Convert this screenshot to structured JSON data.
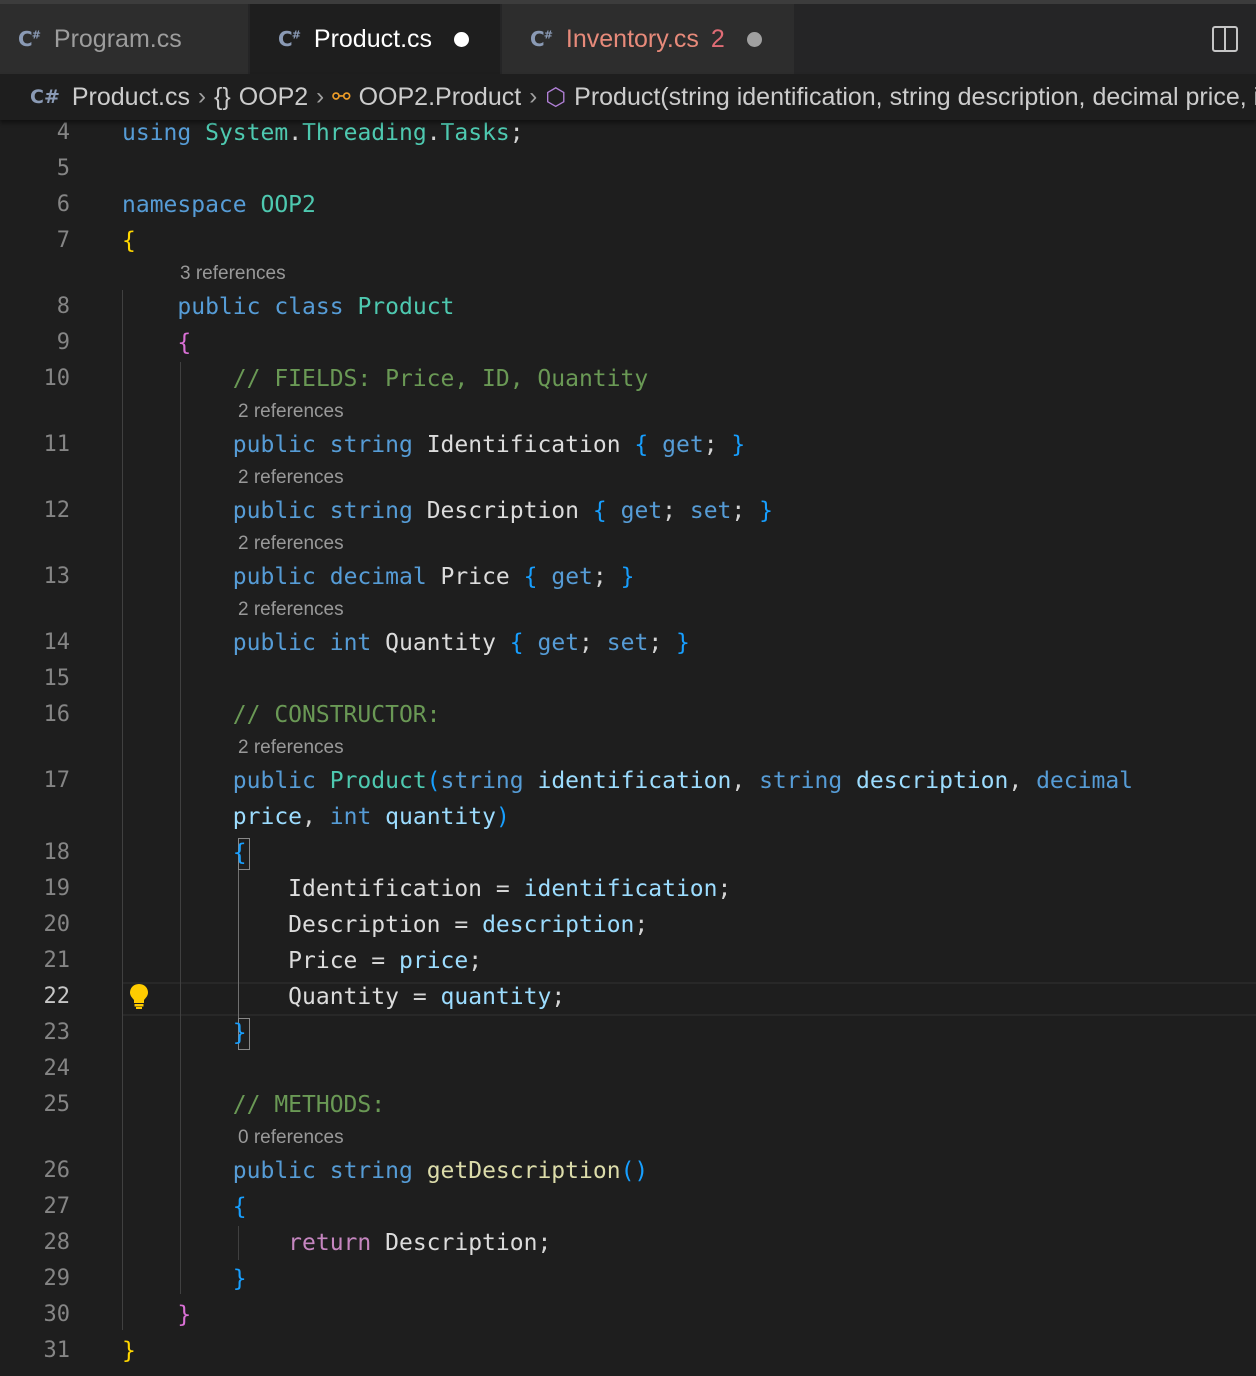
{
  "tabs": [
    {
      "name": "Program.cs",
      "state": "inactive",
      "modified": false,
      "errors": ""
    },
    {
      "name": "Product.cs",
      "state": "active",
      "modified": true,
      "errors": ""
    },
    {
      "name": "Inventory.cs",
      "state": "inactive",
      "modified": true,
      "errors": "2"
    }
  ],
  "breadcrumb": {
    "file": "Product.cs",
    "namespace": "OOP2",
    "class": "OOP2.Product",
    "method": "Product(string identification, string description, decimal price, int quantity)"
  },
  "editor": {
    "current_line": 22,
    "line_numbers": [
      "4",
      "5",
      "6",
      "7",
      "8",
      "9",
      "10",
      "11",
      "12",
      "13",
      "14",
      "15",
      "16",
      "17",
      "18",
      "19",
      "20",
      "21",
      "22",
      "23",
      "24",
      "25",
      "26",
      "27",
      "28",
      "29",
      "30",
      "31"
    ],
    "codelens": {
      "class_product": "3 references",
      "identification": "2 references",
      "description": "2 references",
      "price": "2 references",
      "quantity": "2 references",
      "constructor": "2 references",
      "get_description": "0 references"
    },
    "code": {
      "l4": [
        "using",
        "System",
        ".",
        "Threading",
        ".",
        "Tasks",
        ";"
      ],
      "l6": [
        "namespace",
        "OOP2"
      ],
      "l7": "{",
      "l8": [
        "public",
        "class",
        "Product"
      ],
      "l9": "{",
      "l10": "// FIELDS: Price, ID, Quantity",
      "l11": [
        "public",
        "string",
        "Identification",
        "{",
        "get",
        ";",
        "}"
      ],
      "l12": [
        "public",
        "string",
        "Description",
        "{",
        "get",
        ";",
        "set",
        ";",
        "}"
      ],
      "l13": [
        "public",
        "decimal",
        "Price",
        "{",
        "get",
        ";",
        "}"
      ],
      "l14": [
        "public",
        "int",
        "Quantity",
        "{",
        "get",
        ";",
        "set",
        ";",
        "}"
      ],
      "l16": "// CONSTRUCTOR:",
      "l17a": [
        "public",
        "Product",
        "(",
        "string",
        "identification",
        ",",
        "string",
        "description",
        ",",
        "decimal"
      ],
      "l17b": [
        "price",
        ",",
        "int",
        "quantity",
        ")"
      ],
      "l18": "{",
      "l19": [
        "Identification",
        "=",
        "identification",
        ";"
      ],
      "l20": [
        "Description",
        "=",
        "description",
        ";"
      ],
      "l21": [
        "Price",
        "=",
        "price",
        ";"
      ],
      "l22": [
        "Quantity",
        "=",
        "quantity",
        ";"
      ],
      "l23": "}",
      "l25": "// METHODS:",
      "l26": [
        "public",
        "string",
        "getDescription",
        "()"
      ],
      "l27": "{",
      "l28": [
        "return",
        "Description",
        ";"
      ],
      "l29": "}",
      "l30": "}",
      "l31": "}"
    }
  },
  "icons": {
    "file_icon": "csharp-icon",
    "lightbulb": "lightbulb-icon",
    "split": "split-editor-icon"
  },
  "colors": {
    "background": "#1e1e1e",
    "keyword": "#569cd6",
    "type": "#4ec9b0",
    "comment": "#6a9955",
    "variable": "#9cdcfe",
    "lightbulb": "#ffcc00"
  }
}
